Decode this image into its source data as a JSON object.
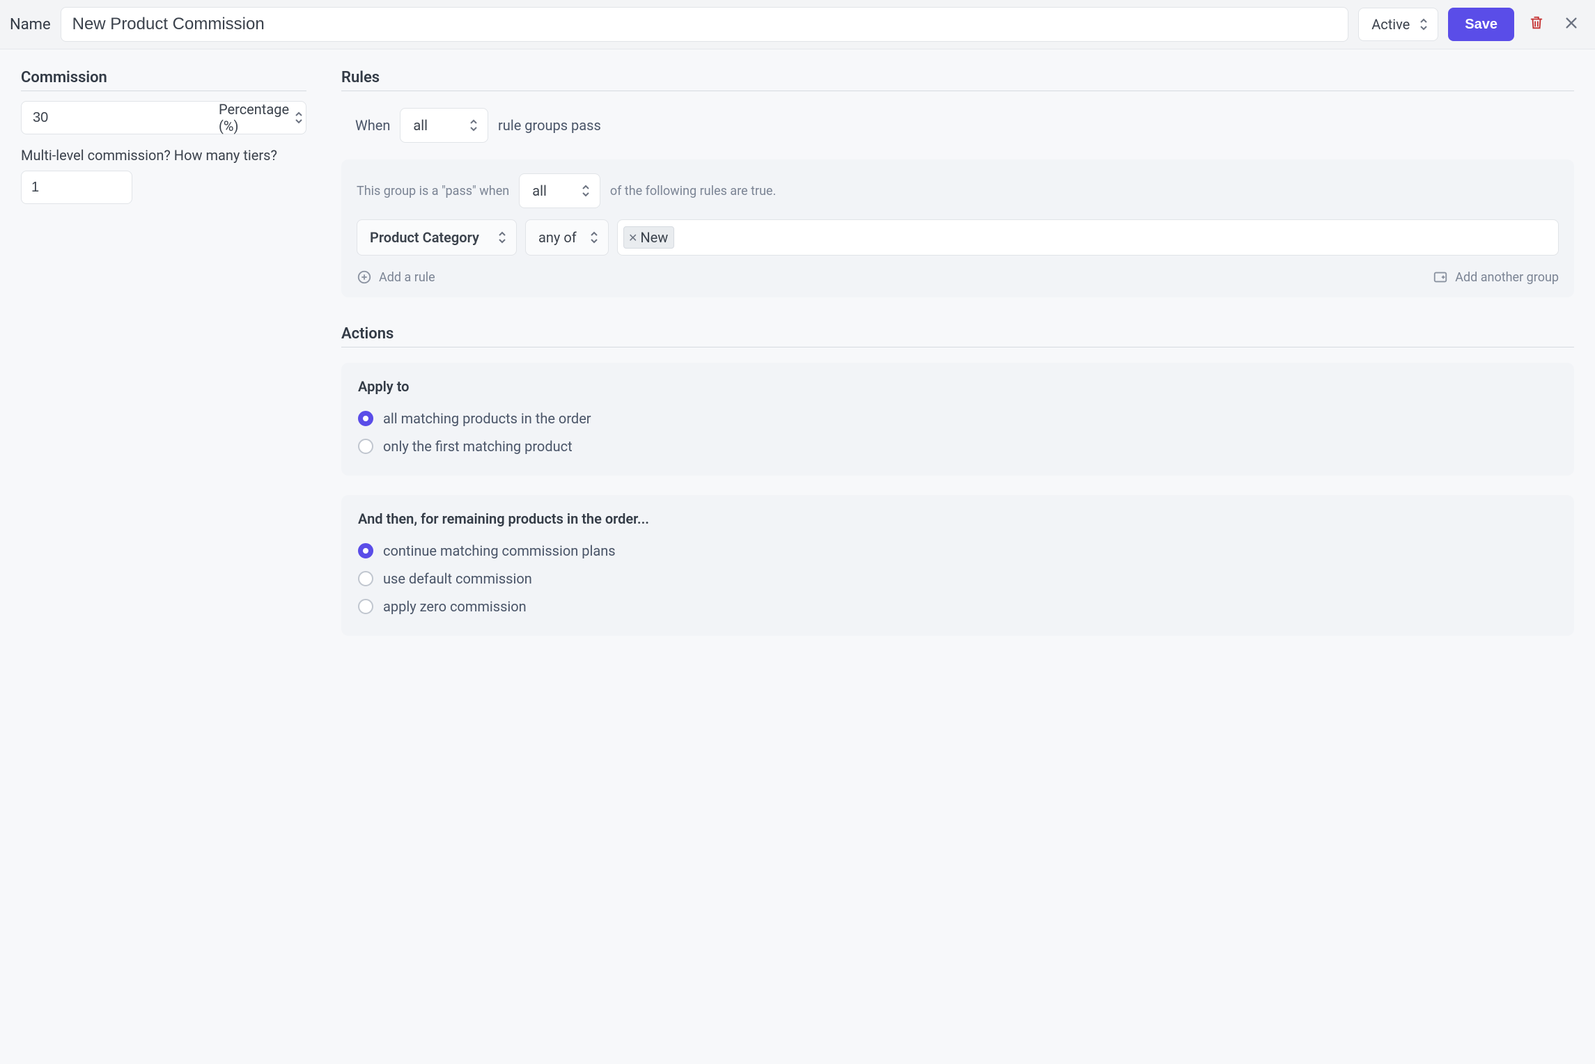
{
  "header": {
    "name_label": "Name",
    "name_value": "New Product Commission",
    "status_value": "Active",
    "save_label": "Save"
  },
  "commission": {
    "title": "Commission",
    "value": "30",
    "type_label": "Percentage (%)",
    "tiers_label": "Multi-level commission? How many tiers?",
    "tiers_value": "1"
  },
  "rules": {
    "title": "Rules",
    "when_label": "When",
    "match_mode": "all",
    "when_suffix": "rule groups pass",
    "group_prefix": "This group is a \"pass\" when",
    "group_mode": "all",
    "group_suffix": "of the following rules are true.",
    "rule": {
      "field": "Product Category",
      "operator": "any of",
      "tags": [
        "New"
      ]
    },
    "add_rule_label": "Add a rule",
    "add_group_label": "Add another group"
  },
  "actions": {
    "title": "Actions",
    "apply_to": {
      "heading": "Apply to",
      "options": [
        {
          "label": "all matching products in the order",
          "selected": true
        },
        {
          "label": "only the first matching product",
          "selected": false
        }
      ]
    },
    "remaining": {
      "heading": "And then, for remaining products in the order...",
      "options": [
        {
          "label": "continue matching commission plans",
          "selected": true
        },
        {
          "label": "use default commission",
          "selected": false
        },
        {
          "label": "apply zero commission",
          "selected": false
        }
      ]
    }
  }
}
